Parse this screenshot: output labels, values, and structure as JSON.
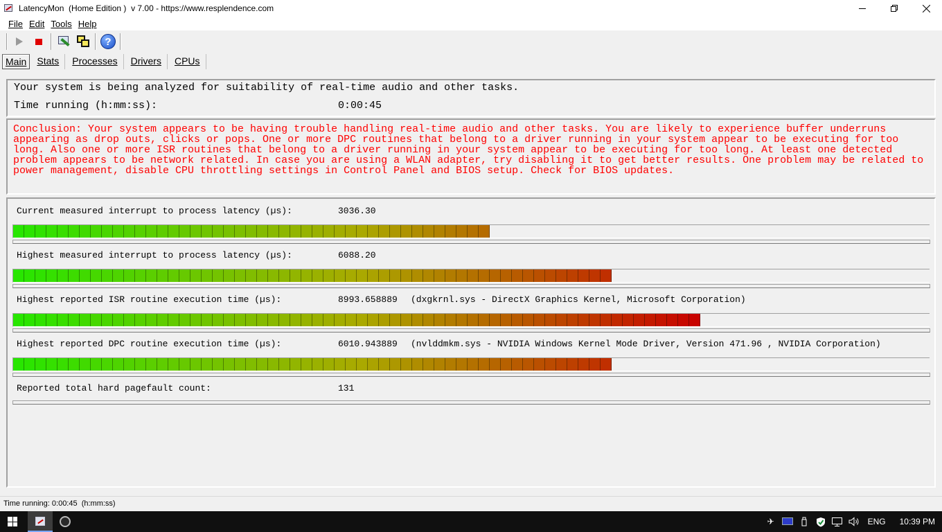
{
  "window": {
    "title": "LatencyMon  (Home Edition )  v 7.00 - https://www.resplendence.com",
    "controls": [
      "minimize",
      "restore",
      "close"
    ]
  },
  "menu": [
    {
      "label": "File"
    },
    {
      "label": "Edit"
    },
    {
      "label": "Tools"
    },
    {
      "label": "Help"
    }
  ],
  "toolbar": {
    "icons": [
      "play-icon",
      "stop-icon",
      "tool-icon",
      "windows-icon",
      "help-icon"
    ],
    "help_glyph": "?"
  },
  "tabs": [
    {
      "label": "Main"
    },
    {
      "label": "Stats"
    },
    {
      "label": "Processes"
    },
    {
      "label": "Drivers"
    },
    {
      "label": "CPUs"
    }
  ],
  "summary": {
    "analysis_text": "Your system is being analyzed for suitability of real-time audio and other tasks.",
    "time_label": "Time running (h:mm:ss):",
    "time_value": "0:00:45"
  },
  "conclusion": "Conclusion: Your system appears to be having trouble handling real-time audio and other tasks. You are likely to experience buffer underruns appearing as drop outs, clicks or pops. One or more DPC routines that belong to a driver running in your system appear to be executing for too long. Also one or more ISR routines that belong to a driver running in your system appear to be executing for too long. At least one detected problem appears to be network related. In case you are using a WLAN adapter, try disabling it to get better results. One problem may be related to power management, disable CPU throttling settings in Control Panel and BIOS setup. Check for BIOS updates.",
  "metrics": [
    {
      "label": "Current measured interrupt to process latency (µs):",
      "value": "3036.30",
      "extra": "",
      "level": 0.52
    },
    {
      "label": "Highest measured interrupt to process latency (µs):",
      "value": "6088.20",
      "extra": "",
      "level": 0.66
    },
    {
      "label": "Highest reported ISR routine execution time (µs):",
      "value": "8993.658889",
      "extra": "(dxgkrnl.sys - DirectX Graphics Kernel, Microsoft Corporation)",
      "level": 0.75
    },
    {
      "label": "Highest reported DPC routine execution time (µs):",
      "value": "6010.943889",
      "extra": "(nvlddmkm.sys - NVIDIA Windows Kernel Mode Driver, Version 471.96 , NVIDIA Corporation)",
      "level": 0.66
    },
    {
      "label": "Reported total hard pagefault count:",
      "value": "131",
      "extra": ""
    }
  ],
  "statusbar": {
    "text": "Time running: 0:00:45  (h:mm:ss)"
  },
  "taskbar": {
    "language": "ENG",
    "clock": "10:39 PM",
    "tray_icons": [
      "airplane-icon",
      "display-icon",
      "usb-icon",
      "shield-icon",
      "network-icon",
      "volume-icon"
    ]
  }
}
